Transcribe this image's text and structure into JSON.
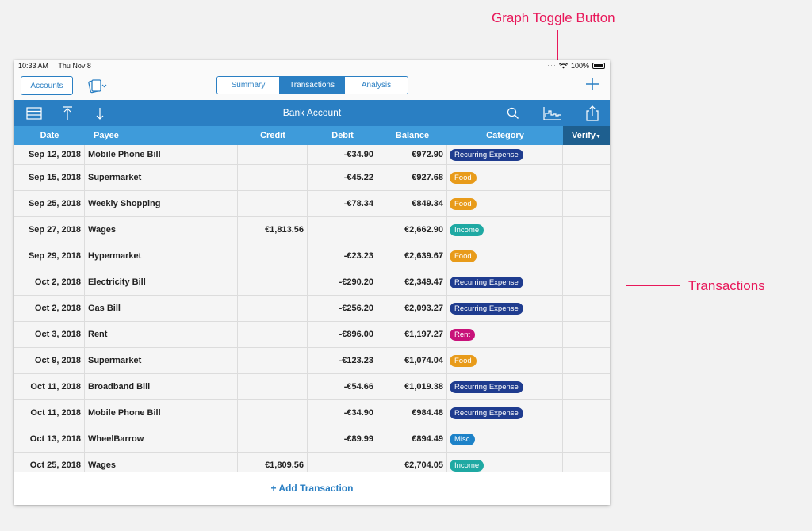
{
  "annotations": {
    "graph_toggle_label": "Graph Toggle Button",
    "transactions_label": "Transactions"
  },
  "status_bar": {
    "time": "10:33 AM",
    "date": "Thu Nov 8",
    "battery": "100%"
  },
  "nav": {
    "accounts_label": "Accounts",
    "tabs": [
      {
        "label": "Summary",
        "active": false
      },
      {
        "label": "Transactions",
        "active": true
      },
      {
        "label": "Analysis",
        "active": false
      }
    ]
  },
  "toolbar": {
    "title": "Bank Account"
  },
  "columns": {
    "date": "Date",
    "payee": "Payee",
    "credit": "Credit",
    "debit": "Debit",
    "balance": "Balance",
    "category": "Category",
    "verify": "Verify"
  },
  "category_colors": {
    "Recurring Expense": "#1f3c8f",
    "Food": "#e89b1a",
    "Income": "#1fa9a3",
    "Rent": "#c8127a",
    "Misc": "#1d82c8"
  },
  "transactions": [
    {
      "date": "Sep 12, 2018",
      "payee": "Mobile Phone Bill",
      "credit": "",
      "debit": "-€34.90",
      "balance": "€972.90",
      "category": "Recurring Expense"
    },
    {
      "date": "Sep 15, 2018",
      "payee": "Supermarket",
      "credit": "",
      "debit": "-€45.22",
      "balance": "€927.68",
      "category": "Food"
    },
    {
      "date": "Sep 25, 2018",
      "payee": "Weekly Shopping",
      "credit": "",
      "debit": "-€78.34",
      "balance": "€849.34",
      "category": "Food"
    },
    {
      "date": "Sep 27, 2018",
      "payee": "Wages",
      "credit": "€1,813.56",
      "debit": "",
      "balance": "€2,662.90",
      "category": "Income"
    },
    {
      "date": "Sep 29, 2018",
      "payee": "Hypermarket",
      "credit": "",
      "debit": "-€23.23",
      "balance": "€2,639.67",
      "category": "Food"
    },
    {
      "date": "Oct 2, 2018",
      "payee": "Electricity Bill",
      "credit": "",
      "debit": "-€290.20",
      "balance": "€2,349.47",
      "category": "Recurring Expense"
    },
    {
      "date": "Oct 2, 2018",
      "payee": "Gas Bill",
      "credit": "",
      "debit": "-€256.20",
      "balance": "€2,093.27",
      "category": "Recurring Expense"
    },
    {
      "date": "Oct 3, 2018",
      "payee": "Rent",
      "credit": "",
      "debit": "-€896.00",
      "balance": "€1,197.27",
      "category": "Rent"
    },
    {
      "date": "Oct 9, 2018",
      "payee": "Supermarket",
      "credit": "",
      "debit": "-€123.23",
      "balance": "€1,074.04",
      "category": "Food"
    },
    {
      "date": "Oct 11, 2018",
      "payee": "Broadband Bill",
      "credit": "",
      "debit": "-€54.66",
      "balance": "€1,019.38",
      "category": "Recurring Expense"
    },
    {
      "date": "Oct 11, 2018",
      "payee": "Mobile Phone Bill",
      "credit": "",
      "debit": "-€34.90",
      "balance": "€984.48",
      "category": "Recurring Expense"
    },
    {
      "date": "Oct 13, 2018",
      "payee": "WheelBarrow",
      "credit": "",
      "debit": "-€89.99",
      "balance": "€894.49",
      "category": "Misc"
    },
    {
      "date": "Oct 25, 2018",
      "payee": "Wages",
      "credit": "€1,809.56",
      "debit": "",
      "balance": "€2,704.05",
      "category": "Income"
    }
  ],
  "footer": {
    "add_label": "+ Add Transaction"
  }
}
